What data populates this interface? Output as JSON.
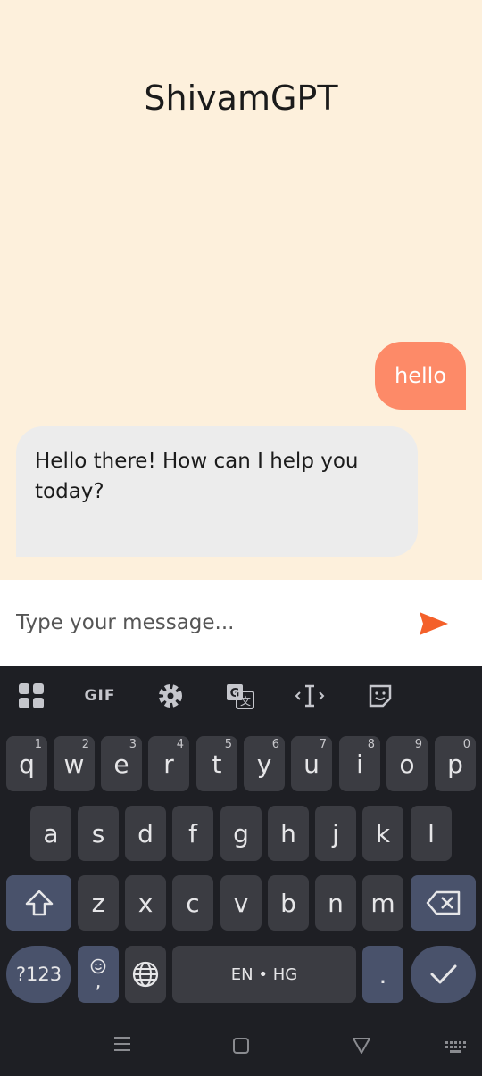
{
  "app": {
    "title": "ShivamGPT",
    "messages": [
      {
        "role": "user",
        "text": "hello"
      },
      {
        "role": "assistant",
        "text": "Hello there! How can I help you today?"
      }
    ],
    "composer": {
      "placeholder": "Type your message..."
    }
  },
  "keyboard": {
    "toolbar": [
      {
        "icon": "apps-grid-icon"
      },
      {
        "label": "GIF"
      },
      {
        "icon": "gear-icon"
      },
      {
        "icon": "translate-icon"
      },
      {
        "icon": "cursor-control-icon"
      },
      {
        "icon": "sticker-icon"
      }
    ],
    "row1": [
      {
        "k": "q",
        "h": "1"
      },
      {
        "k": "w",
        "h": "2"
      },
      {
        "k": "e",
        "h": "3"
      },
      {
        "k": "r",
        "h": "4"
      },
      {
        "k": "t",
        "h": "5"
      },
      {
        "k": "y",
        "h": "6"
      },
      {
        "k": "u",
        "h": "7"
      },
      {
        "k": "i",
        "h": "8"
      },
      {
        "k": "o",
        "h": "9"
      },
      {
        "k": "p",
        "h": "0"
      }
    ],
    "row2": [
      "a",
      "s",
      "d",
      "f",
      "g",
      "h",
      "j",
      "k",
      "l"
    ],
    "row3": [
      "z",
      "x",
      "c",
      "v",
      "b",
      "n",
      "m"
    ],
    "symbols_label": "?123",
    "emoji_comma_label": ",",
    "space_label": "EN • HG",
    "period_label": "."
  }
}
